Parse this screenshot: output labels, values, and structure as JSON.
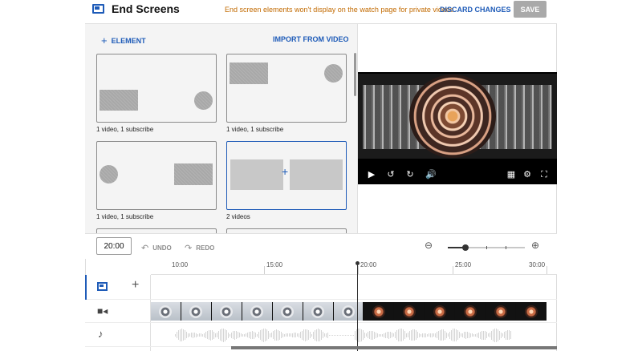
{
  "header": {
    "title": "End Screens",
    "notice": "End screen elements won't display on the watch page for private videos.",
    "discard_label": "DISCARD CHANGES",
    "save_label": "SAVE"
  },
  "panel": {
    "add_element_label": "ELEMENT",
    "import_label": "IMPORT FROM VIDEO",
    "templates": [
      {
        "label": "1 video, 1 subscribe"
      },
      {
        "label": "1 video, 1 subscribe"
      },
      {
        "label": "1 video, 1 subscribe"
      },
      {
        "label": "2 videos"
      }
    ]
  },
  "timeline": {
    "time_value": "20:00",
    "undo_label": "UNDO",
    "redo_label": "REDO",
    "zoom_level": 0.23,
    "ruler_ticks": [
      "10:00",
      "15:00",
      "20:00",
      "25:00",
      "30:00"
    ]
  },
  "icons": {
    "add": "plus-icon",
    "undo": "undo-icon",
    "redo": "redo-icon",
    "zoom_out": "zoom-out-icon",
    "zoom_in": "zoom-in-icon",
    "play": "play-icon",
    "rewind": "rewind-icon",
    "forward": "forward-icon",
    "volume": "volume-icon",
    "grid": "grid-icon",
    "settings": "gear-icon",
    "fullscreen": "fullscreen-icon"
  },
  "colors": {
    "accent": "#1e5bb8",
    "notice": "#c26a00",
    "save_disabled": "#a9a9a9"
  }
}
